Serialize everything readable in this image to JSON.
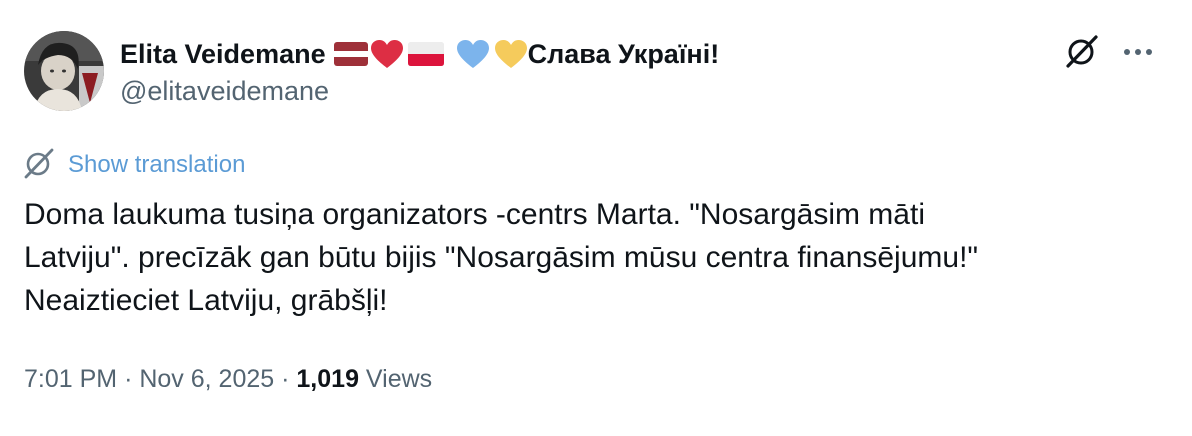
{
  "author": {
    "display_name": "Elita Veidemane",
    "name_suffix": "Слава Україні!",
    "handle": "@elitaveidemane",
    "name_emojis": [
      "latvia-flag-icon",
      "red-heart-icon",
      "poland-flag-icon",
      "blue-heart-icon",
      "yellow-heart-icon"
    ]
  },
  "actions": {
    "grok_icon": "grok-icon",
    "more_icon": "more-options-icon"
  },
  "translation": {
    "label": "Show translation",
    "icon": "translate-icon"
  },
  "tweet": {
    "lines": [
      "Doma laukuma tusiņa organizators -centrs Marta. \"Nosargāsim māti",
      "Latviju\". precīzāk gan būtu bijis \"Nosargāsim mūsu centra finansējumu!\"",
      "Neaiztieciet Latviju, grābšļi!"
    ]
  },
  "meta": {
    "time": "7:01 PM",
    "separator": "·",
    "date": "Nov 6, 2025",
    "views_count": "1,019",
    "views_label": "Views"
  },
  "colors": {
    "text": "#0f1419",
    "muted": "#536471",
    "link": "#5b9bd5",
    "latvia_red": "#9e3039",
    "heart_red": "#dd2e44",
    "poland_red": "#dc143c",
    "heart_blue": "#7cb4ec",
    "heart_yellow": "#f5cb5c"
  }
}
